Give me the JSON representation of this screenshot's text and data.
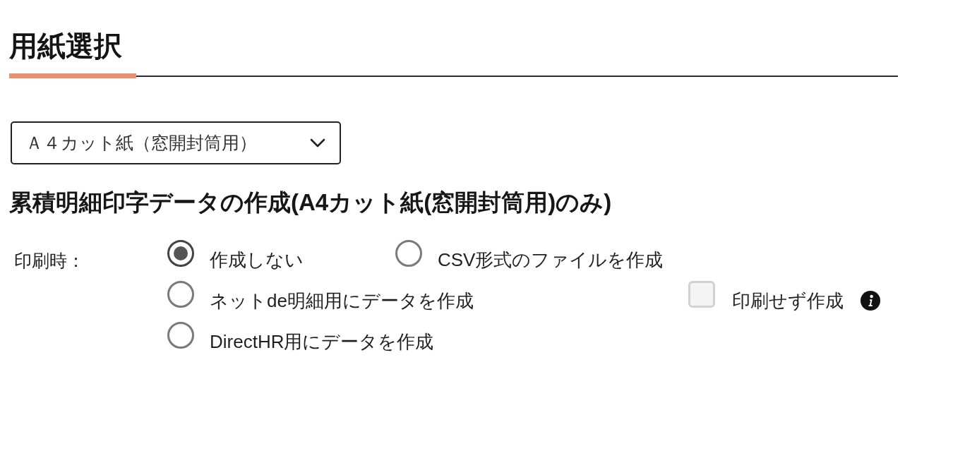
{
  "section": {
    "title": "用紙選択"
  },
  "paper_select": {
    "value": "Ａ４カット紙（窓開封筒用）"
  },
  "accumulated_print": {
    "heading": "累積明細印字データの作成(A4カット紙(窓開封筒用)のみ)",
    "label": "印刷時：",
    "rows": [
      [
        {
          "kind": "radio",
          "label": "作成しない",
          "selected": true
        },
        {
          "kind": "radio",
          "label": "CSV形式のファイルを作成",
          "selected": false
        }
      ],
      [
        {
          "kind": "radio",
          "label": "ネットde明細用にデータを作成",
          "selected": false
        },
        {
          "kind": "checkbox",
          "label": "印刷せず作成",
          "checked": false,
          "disabled": true
        }
      ],
      [
        {
          "kind": "radio",
          "label": "DirectHR用にデータを作成",
          "selected": false
        }
      ]
    ]
  }
}
